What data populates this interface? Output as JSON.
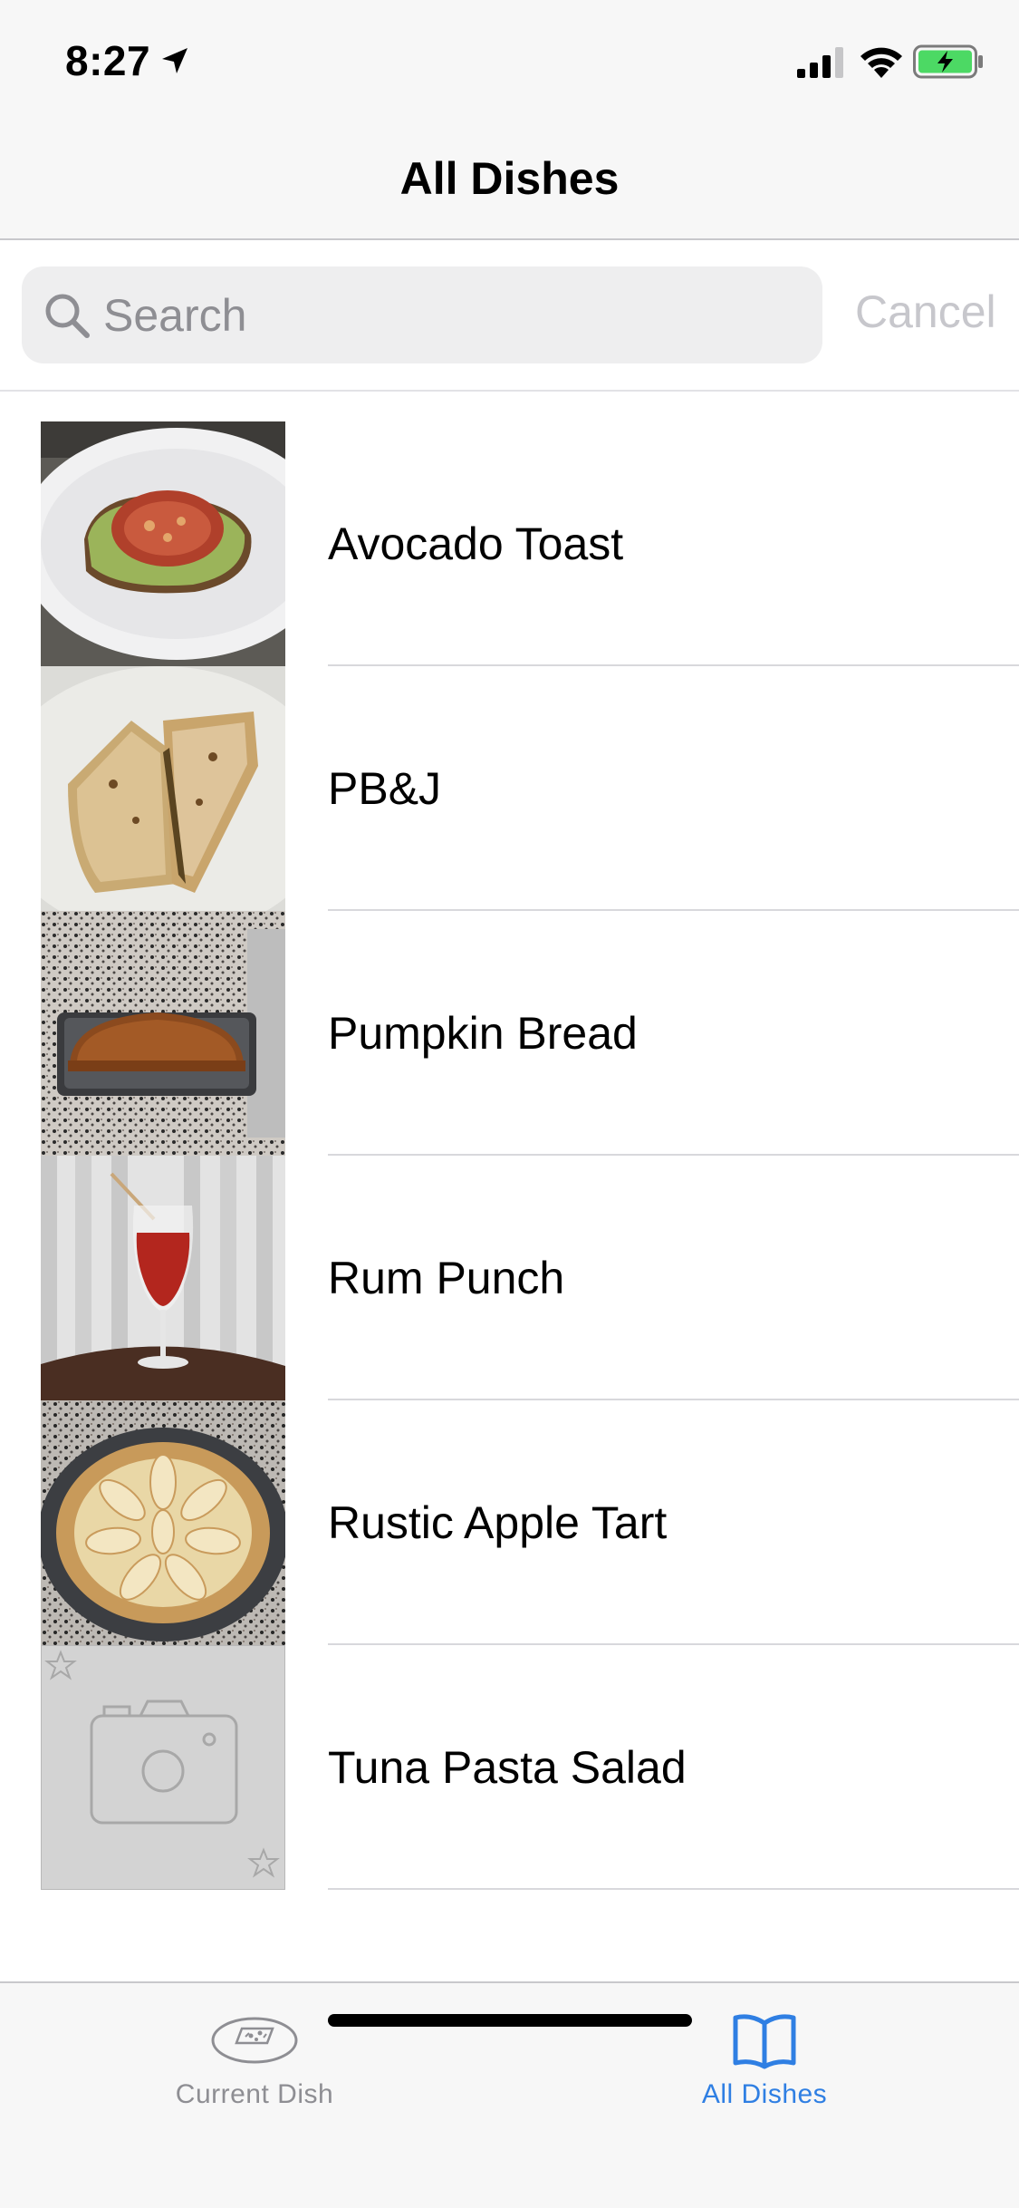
{
  "status_bar": {
    "time": "8:27"
  },
  "nav": {
    "title": "All Dishes"
  },
  "search": {
    "placeholder": "Search",
    "value": "",
    "cancel_label": "Cancel"
  },
  "dishes": [
    {
      "name": "Avocado Toast"
    },
    {
      "name": "PB&J"
    },
    {
      "name": "Pumpkin Bread"
    },
    {
      "name": "Rum Punch"
    },
    {
      "name": "Rustic Apple Tart"
    },
    {
      "name": "Tuna Pasta Salad"
    }
  ],
  "tab_bar": {
    "tabs": [
      {
        "label": "Current Dish",
        "icon": "dish-icon",
        "selected": false
      },
      {
        "label": "All Dishes",
        "icon": "book-icon",
        "selected": true
      }
    ]
  },
  "colors": {
    "accent": "#2f7fe3",
    "inactive": "#8e8e93",
    "battery": "#4cd964"
  }
}
